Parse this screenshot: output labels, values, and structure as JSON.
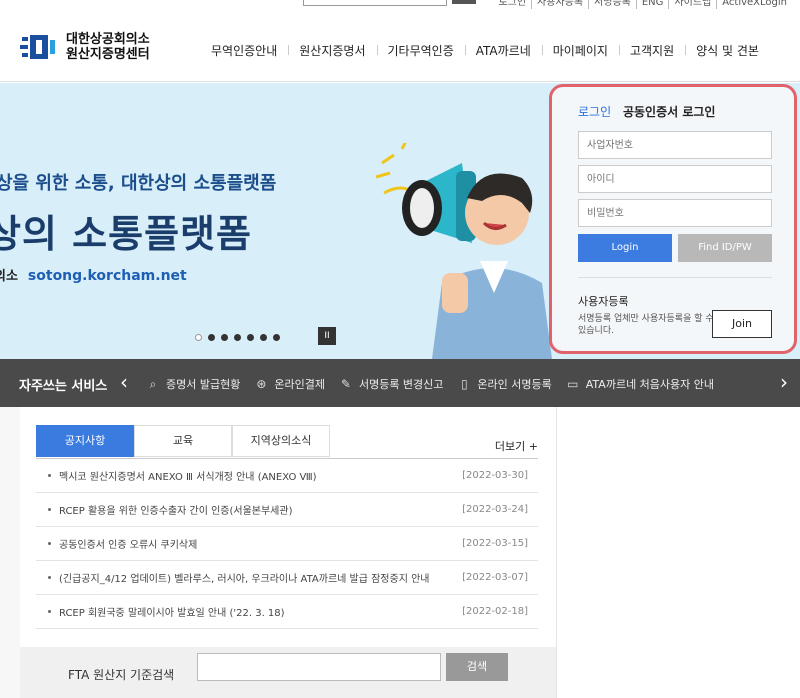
{
  "util": {
    "links": [
      "로그인",
      "사용자등록",
      "서명등록",
      "ENG",
      "사이트맵",
      "ActiveXLogin"
    ]
  },
  "header": {
    "logo_line1": "대한상공회의소",
    "logo_line2": "원산지증명센터",
    "nav": [
      "무역인증안내",
      "원산지증명서",
      "기타무역인증",
      "ATA까르네",
      "마이페이지",
      "고객지원",
      "양식 및 견본"
    ]
  },
  "banner": {
    "line1": "상을 위한 소통, 대한상의 소통플랫폼",
    "line2": "상의 소통플랫폼",
    "line3_prefix": "의소",
    "url": "sotong.korcham.net",
    "slide_count": 7,
    "active_slide": 1,
    "pause_label": "II"
  },
  "login": {
    "tab_login": "로그인",
    "tab_cert": "공동인증서 로그인",
    "business_no_placeholder": "사업자번호",
    "id_placeholder": "아이디",
    "password_placeholder": "비밀번호",
    "login_button": "Login",
    "find_button": "Find ID/PW",
    "register_title": "사용자등록",
    "register_desc": "서명등록 업체만 사용자등록을 할 수 있습니다.",
    "join_button": "Join"
  },
  "quick": {
    "title": "자주쓰는 서비스",
    "items": [
      {
        "icon": "search-icon",
        "label": "증명서 발급현황"
      },
      {
        "icon": "payment-icon",
        "label": "온라인결제"
      },
      {
        "icon": "pen-icon",
        "label": "서명등록 변경신고"
      },
      {
        "icon": "phone-icon",
        "label": "온라인 서명등록"
      },
      {
        "icon": "folder-icon",
        "label": "ATA까르네 처음사용자 안내"
      }
    ]
  },
  "board": {
    "tabs": [
      "공지사항",
      "교육",
      "지역상의소식"
    ],
    "more": "더보기 +",
    "rows": [
      {
        "title": "멕시코 원산지증명서 ANEXO Ⅲ 서식개정 안내 (ANEXO Ⅷ)",
        "date": "[2022-03-30]"
      },
      {
        "title": "RCEP 활용을 위한 인증수출자 간이 인증(서울본부세관)",
        "date": "[2022-03-24]"
      },
      {
        "title": "공동인증서 인증 오류시 쿠키삭제",
        "date": "[2022-03-15]"
      },
      {
        "title": "(긴급공지_4/12 업데이트) 벨라루스, 러시아, 우크라이나 ATA까르네 발급 잠정중지 안내",
        "date": "[2022-03-07]"
      },
      {
        "title": "RCEP 회원국중 말레이시아 발효일 안내 ('22. 3. 18)",
        "date": "[2022-02-18]"
      }
    ]
  },
  "fta": {
    "label": "FTA 원산지 기준검색",
    "input_value": "",
    "button": "검색"
  }
}
